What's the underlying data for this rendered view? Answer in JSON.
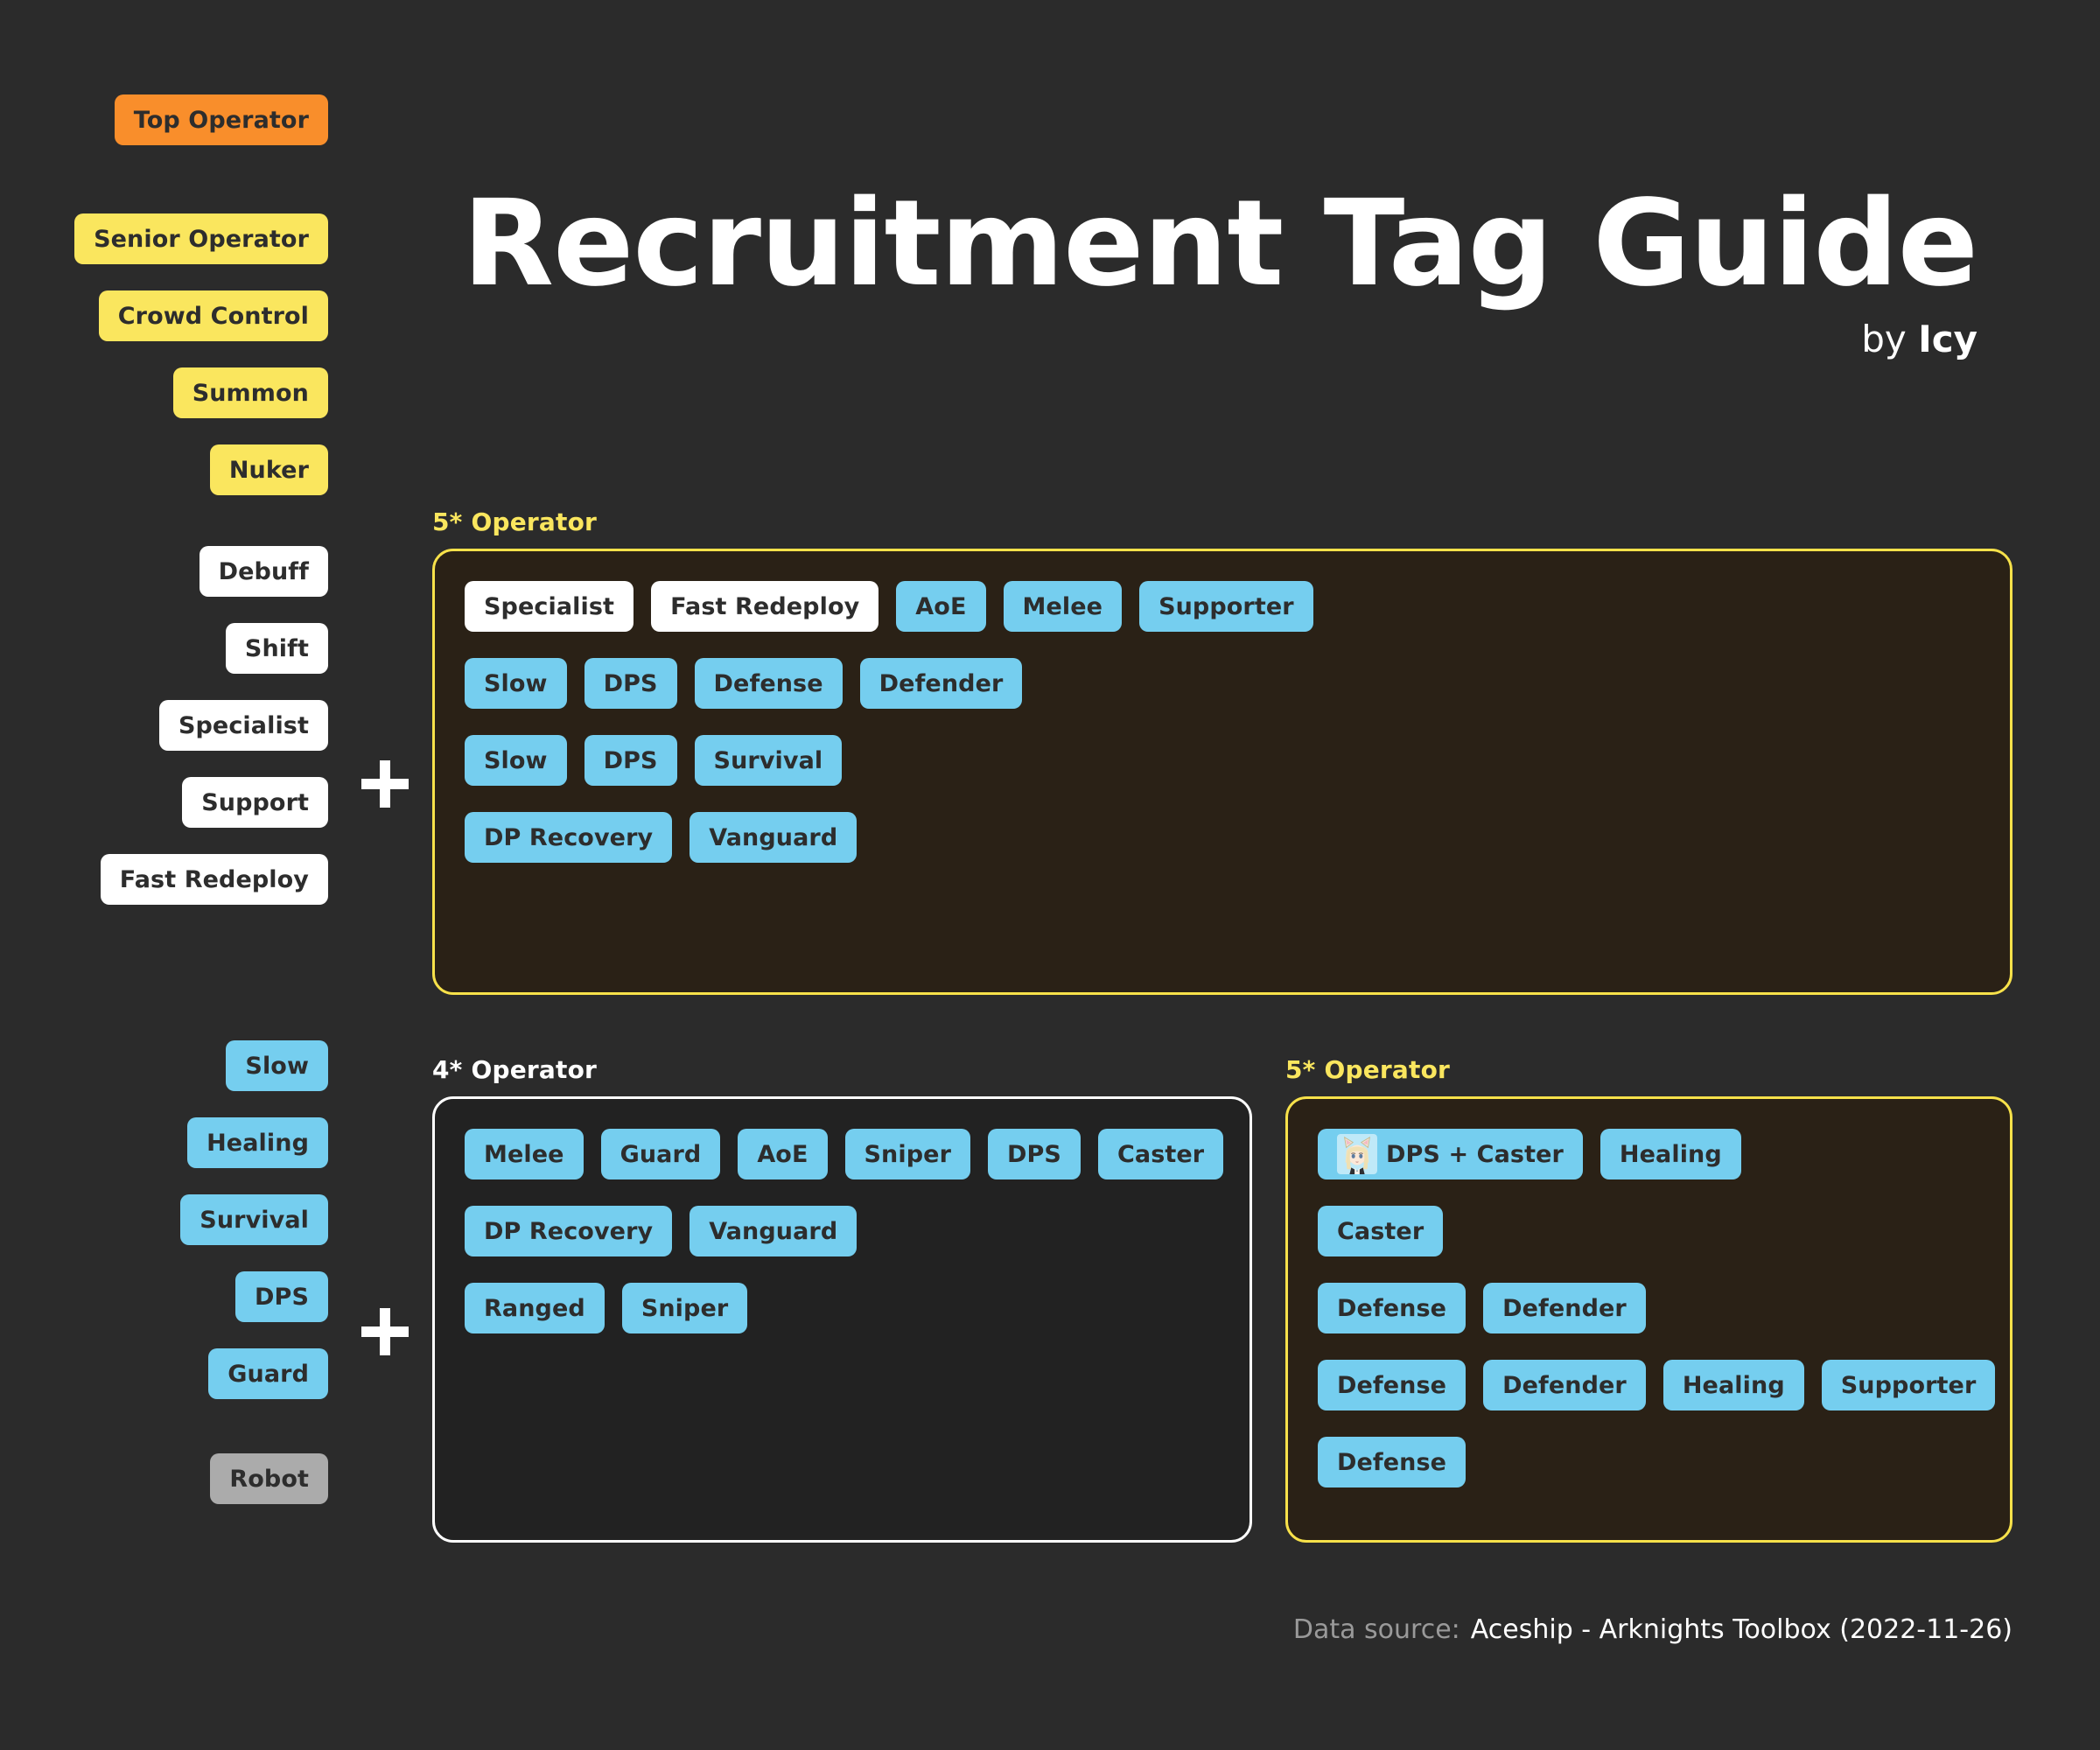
{
  "header": {
    "title": "Recruitment Tag Guide",
    "byline_prefix": "by",
    "byline_author": "Icy"
  },
  "colors": {
    "background": "#2b2b2b",
    "tag_blue": "#75ceef",
    "tag_white": "#ffffff",
    "tag_yellow": "#fae65e",
    "tag_orange": "#f98e2b",
    "tag_gray": "#ababab",
    "panel_5star_border": "#f7e14a",
    "panel_5star_fill": "#2a2116",
    "panel_4star_border": "#ffffff",
    "panel_4star_fill": "#222222",
    "label_yellow": "#fae65e",
    "text_white": "#ffffff",
    "footer_label": "#9a9a9a"
  },
  "left_column": {
    "group_a": [
      {
        "label": "Top Operator",
        "style": "orange"
      },
      {
        "label": "Senior Operator",
        "style": "yellow"
      },
      {
        "label": "Crowd Control",
        "style": "yellow"
      },
      {
        "label": "Summon",
        "style": "yellow"
      },
      {
        "label": "Nuker",
        "style": "yellow"
      },
      {
        "label": "Debuff",
        "style": "white"
      },
      {
        "label": "Shift",
        "style": "white"
      },
      {
        "label": "Specialist",
        "style": "white"
      },
      {
        "label": "Support",
        "style": "white"
      },
      {
        "label": "Fast Redeploy",
        "style": "white"
      }
    ],
    "group_b": [
      {
        "label": "Slow",
        "style": "blue"
      },
      {
        "label": "Healing",
        "style": "blue"
      },
      {
        "label": "Survival",
        "style": "blue"
      },
      {
        "label": "DPS",
        "style": "blue"
      },
      {
        "label": "Guard",
        "style": "blue"
      },
      {
        "label": "Robot",
        "style": "gray"
      }
    ]
  },
  "operator_symbol": "+",
  "panels": {
    "top_5star": {
      "label": "5* Operator",
      "rows": [
        [
          {
            "label": "Specialist",
            "style": "white"
          },
          {
            "label": "Fast Redeploy",
            "style": "white"
          },
          {
            "label": "AoE",
            "style": "blue"
          },
          {
            "label": "Melee",
            "style": "blue"
          },
          {
            "label": "Supporter",
            "style": "blue"
          }
        ],
        [
          {
            "label": "Slow",
            "style": "blue"
          },
          {
            "label": "DPS",
            "style": "blue"
          },
          {
            "label": "Defense",
            "style": "blue"
          },
          {
            "label": "Defender",
            "style": "blue"
          }
        ],
        [
          {
            "label": "Slow",
            "style": "blue"
          },
          {
            "label": "DPS",
            "style": "blue"
          },
          {
            "label": "Survival",
            "style": "blue"
          }
        ],
        [
          {
            "label": "DP Recovery",
            "style": "blue"
          },
          {
            "label": "Vanguard",
            "style": "blue"
          }
        ]
      ]
    },
    "bottom_4star": {
      "label": "4* Operator",
      "rows": [
        [
          {
            "label": "Melee",
            "style": "blue"
          },
          {
            "label": "Guard",
            "style": "blue"
          },
          {
            "label": "AoE",
            "style": "blue"
          },
          {
            "label": "Sniper",
            "style": "blue"
          },
          {
            "label": "DPS",
            "style": "blue"
          },
          {
            "label": "Caster",
            "style": "blue"
          }
        ],
        [
          {
            "label": "DP Recovery",
            "style": "blue"
          },
          {
            "label": "Vanguard",
            "style": "blue"
          }
        ],
        [
          {
            "label": "Ranged",
            "style": "blue"
          },
          {
            "label": "Sniper",
            "style": "blue"
          }
        ]
      ]
    },
    "bottom_5star": {
      "label": "5* Operator",
      "rows": [
        [
          {
            "label": "DPS + Caster",
            "style": "blue",
            "icon": "operator-avatar-icon"
          },
          {
            "label": "Healing",
            "style": "blue"
          }
        ],
        [
          {
            "label": "Caster",
            "style": "blue"
          }
        ],
        [
          {
            "label": "Defense",
            "style": "blue"
          },
          {
            "label": "Defender",
            "style": "blue"
          }
        ],
        [
          {
            "label": "Defense",
            "style": "blue"
          },
          {
            "label": "Defender",
            "style": "blue"
          },
          {
            "label": "Healing",
            "style": "blue"
          },
          {
            "label": "Supporter",
            "style": "blue"
          }
        ],
        [
          {
            "label": "Defense",
            "style": "blue"
          }
        ]
      ]
    }
  },
  "footer": {
    "label": "Data source:",
    "value": "Aceship - Arknights Toolbox (2022-11-26)"
  }
}
